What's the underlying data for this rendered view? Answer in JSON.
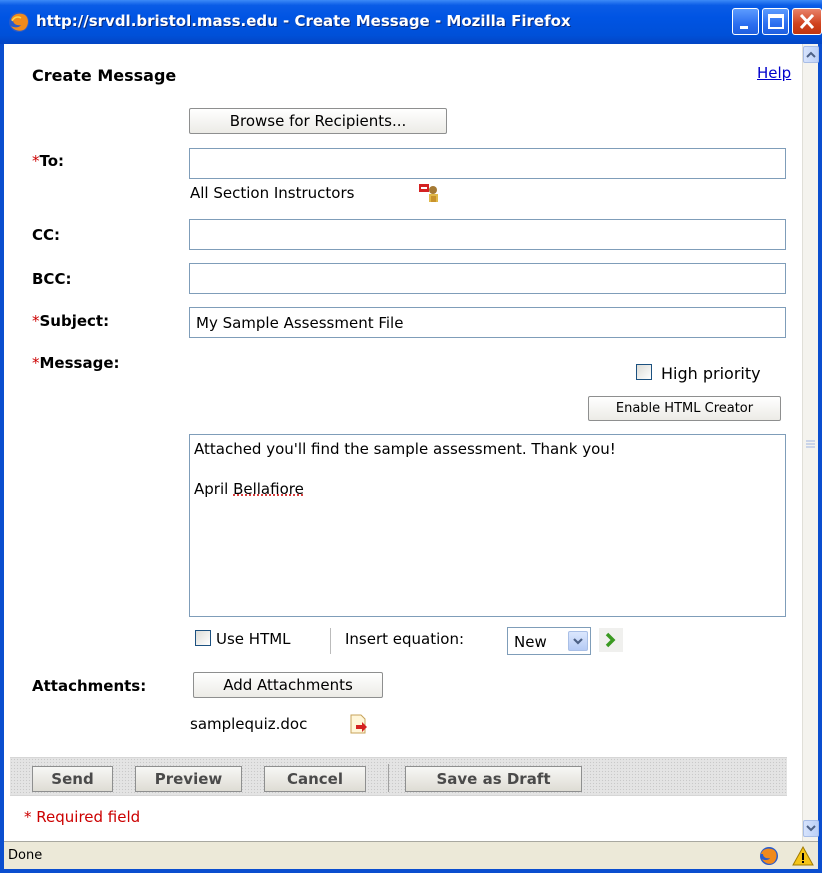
{
  "window": {
    "title": "http://srvdl.bristol.mass.edu - Create Message - Mozilla Firefox",
    "icons": [
      "firefox-icon",
      "minimize-icon",
      "maximize-icon",
      "close-icon"
    ]
  },
  "page": {
    "title": "Create Message",
    "help_label": "Help",
    "browse_recipients_label": "Browse for Recipients...",
    "required_marker": "*"
  },
  "form": {
    "to": {
      "label": "To:",
      "value": "",
      "recipient_text": "All Section Instructors",
      "recipient_icon": "remove-recipient-icon"
    },
    "cc": {
      "label": "CC:",
      "value": ""
    },
    "bcc": {
      "label": "BCC:",
      "value": ""
    },
    "subject": {
      "label": "Subject:",
      "value": "My Sample Assessment File"
    },
    "message": {
      "label": "Message:",
      "high_priority_label": "High priority",
      "high_priority_checked": false,
      "enable_html_label": "Enable HTML Creator",
      "body_line1": "Attached you'll find the sample assessment. Thank you!",
      "body_line2_first": "April",
      "body_line2_last": "Bellafiore",
      "use_html_label": "Use HTML",
      "use_html_checked": false,
      "insert_equation_label": "Insert equation:",
      "equation_option": "New"
    },
    "attachments": {
      "label": "Attachments:",
      "add_label": "Add Attachments",
      "file_name": "samplequiz.doc",
      "file_icon": "remove-attachment-icon"
    }
  },
  "actions": {
    "send": "Send",
    "preview": "Preview",
    "cancel": "Cancel",
    "save_draft": "Save as Draft"
  },
  "required_note": "* Required field",
  "status": {
    "text": "Done",
    "icons": [
      "firefox-status-icon",
      "warning-icon"
    ]
  },
  "colors": {
    "titlebar": "#0054e3",
    "required": "#cc0000",
    "link": "#0000cc"
  }
}
